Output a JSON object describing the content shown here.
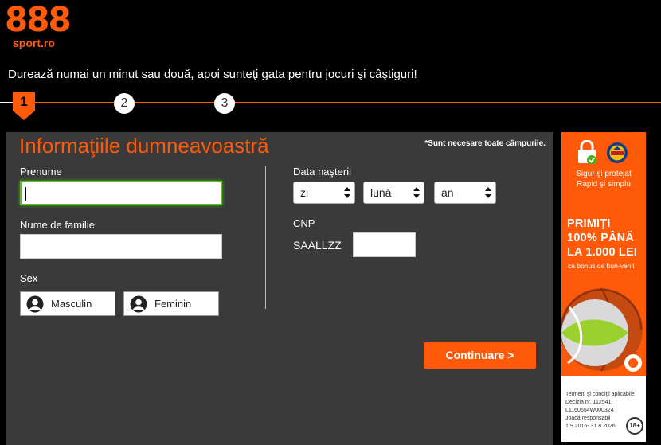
{
  "logo": {
    "brand": "888",
    "sub": "sport.ro"
  },
  "tagline": "Durează numai un minut sau două, apoi sunteţi gata pentru jocuri şi câştiguri!",
  "steps": [
    "1",
    "2",
    "3"
  ],
  "form": {
    "title": "Informaţiile dumneavoastră",
    "required_note": "*Sunt necesare toate câmpurile.",
    "first_name_label": "Prenume",
    "first_name_value": "",
    "last_name_label": "Nume de familie",
    "last_name_value": "",
    "sex_label": "Sex",
    "sex_male": "Masculin",
    "sex_female": "Feminin",
    "dob_label": "Data naşterii",
    "dob_day": "zi",
    "dob_month": "lună",
    "dob_year": "an",
    "cnp_label": "CNP",
    "cnp_prefix": "SAALLZZ",
    "cnp_value": "",
    "continue_label": "Continuare >"
  },
  "ad": {
    "line1": "Sigur şi protejat",
    "line2": "Rapid şi simplu",
    "headline": [
      "PRIMIŢI",
      "100% PÂNĂ",
      "LA 1.000 LEI"
    ],
    "sub": "ca bonus de bun-venit",
    "terms": [
      "Termeni şi condiţii aplicabile",
      "Decizia nr. 112541,",
      "L1160654W000324",
      "Joacă responsabil",
      "1.9.2016- 31.8.2026"
    ],
    "age_badge": "18+"
  },
  "colors": {
    "accent": "#ff5a0a",
    "panel": "#3a3a3a",
    "focus": "#5dbd2b"
  },
  "icons": {
    "lock": "lock-icon",
    "badge": "onjn-badge-icon",
    "user": "user-icon",
    "select": "select-arrows-icon"
  }
}
